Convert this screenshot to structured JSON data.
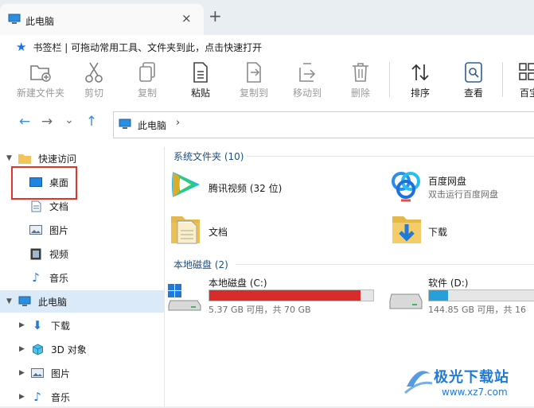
{
  "tab": {
    "title": "此电脑",
    "close": "×",
    "new_tab": "+"
  },
  "bookmarks": {
    "text": "书签栏 | 可拖动常用工具、文件夹到此，点击快速打开"
  },
  "toolbar": [
    {
      "label": "新建文件夹",
      "icon": "new-folder-icon",
      "enabled": false
    },
    {
      "label": "剪切",
      "icon": "scissors-icon",
      "enabled": false
    },
    {
      "label": "复制",
      "icon": "copy-icon",
      "enabled": false
    },
    {
      "label": "粘贴",
      "icon": "paste-icon",
      "enabled": true
    },
    {
      "label": "复制到",
      "icon": "copy-to-icon",
      "enabled": false
    },
    {
      "label": "移动到",
      "icon": "move-to-icon",
      "enabled": false
    },
    {
      "label": "删除",
      "icon": "trash-icon",
      "enabled": false
    },
    {
      "label": "排序",
      "icon": "sort-icon",
      "enabled": true
    },
    {
      "label": "查看",
      "icon": "view-icon",
      "enabled": true
    },
    {
      "label": "百宝",
      "icon": "toolbox-icon",
      "enabled": true
    }
  ],
  "nav": {
    "back": "←",
    "forward": "→",
    "history": "⌄",
    "up": "↑"
  },
  "address": {
    "text": "此电脑",
    "chevron": "›"
  },
  "sidebar": {
    "quick_access": "快速访问",
    "items": [
      "桌面",
      "文档",
      "图片",
      "视频",
      "音乐"
    ],
    "this_pc": "此电脑",
    "pc_items": [
      "下载",
      "3D 对象",
      "图片",
      "音乐"
    ]
  },
  "main": {
    "system_folders_header": "系统文件夹 (10)",
    "folders": [
      {
        "name": "腾讯视频 (32 位)",
        "sub": ""
      },
      {
        "name": "百度网盘",
        "sub": "双击运行百度网盘"
      },
      {
        "name": "文档",
        "sub": ""
      },
      {
        "name": "下载",
        "sub": ""
      }
    ],
    "disks_header": "本地磁盘 (2)",
    "disks": [
      {
        "name": "本地磁盘 (C:)",
        "info": "5.37 GB 可用，共 70 GB",
        "used_fraction": 0.923,
        "bar_color": "#da2b2b"
      },
      {
        "name": "软件 (D:)",
        "info": "144.85 GB 可用，共 16",
        "used_fraction": 0.17,
        "bar_color": "#26a0da"
      }
    ]
  },
  "watermark": {
    "title": "极光下载站",
    "url": "www.xz7.com"
  },
  "colors": {
    "accent": "#1a73e8",
    "selection": "#dbeaf8",
    "highlight_box": "#e0352c"
  }
}
